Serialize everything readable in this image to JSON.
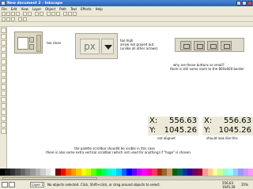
{
  "window": {
    "title": "New document 2 - Inkscape"
  },
  "menu": [
    "File",
    "Edit",
    "View",
    "Layer",
    "Object",
    "Path",
    "Text",
    "Effects",
    "Help"
  ],
  "annotations": {
    "too_close": "too close",
    "too_high": "too high",
    "arrow_not_grayed": "arrow not grayed out",
    "unlike_arrows": "(unlike all other arrows)",
    "why_small": "why are these buttons so small?",
    "still_room": "there is still some room to the 800x600 border",
    "not_aligned": "not aligned",
    "should_look": "should look like this",
    "palette_scrollbar": "the palette scrollbar shoudld be visible in this case",
    "extra_vertical": "there is also some extra vertical scrollbar (which isnt used for anything) if \"huge\" is chosen"
  },
  "unit_dropdown": {
    "value": "px"
  },
  "coords_not_aligned": {
    "x_label": "X:",
    "x_value": "556.63",
    "y_label": "Y:",
    "y_value": "1045.26"
  },
  "coords_correct": {
    "x_label": "X:",
    "x_value": "556.63",
    "y_label": "Y:",
    "y_value": "1045.26"
  },
  "statusbar": {
    "layer": "Layer 1",
    "message": "No objects selected. Click, Shift+click, or drag around objects to select.",
    "x": "556.63",
    "y": "1045.26",
    "zoom": "35%"
  },
  "palette_colors": [
    "#000000",
    "#1a1a1a",
    "#333333",
    "#4d4d4d",
    "#666666",
    "#808080",
    "#999999",
    "#b3b3b3",
    "#cccccc",
    "#e6e6e6",
    "#ffffff",
    "#800000",
    "#ff0000",
    "#ff6600",
    "#ff9900",
    "#ffcc00",
    "#ffff00",
    "#ccff00",
    "#66ff00",
    "#00ff00",
    "#00ff66",
    "#00ffcc",
    "#00ffff",
    "#00ccff",
    "#0066ff",
    "#0000ff",
    "#6600ff",
    "#cc00ff",
    "#ff00ff",
    "#ff0099",
    "#ff3366",
    "#993300",
    "#996633",
    "#cc9966",
    "#006600",
    "#006666",
    "#003399",
    "#330099",
    "#660066",
    "#990033",
    "#ff9999",
    "#ffcc99",
    "#ffff99",
    "#ccff99",
    "#99ffcc",
    "#99ffff",
    "#99ccff",
    "#9999ff",
    "#cc99ff",
    "#ff99ff"
  ]
}
